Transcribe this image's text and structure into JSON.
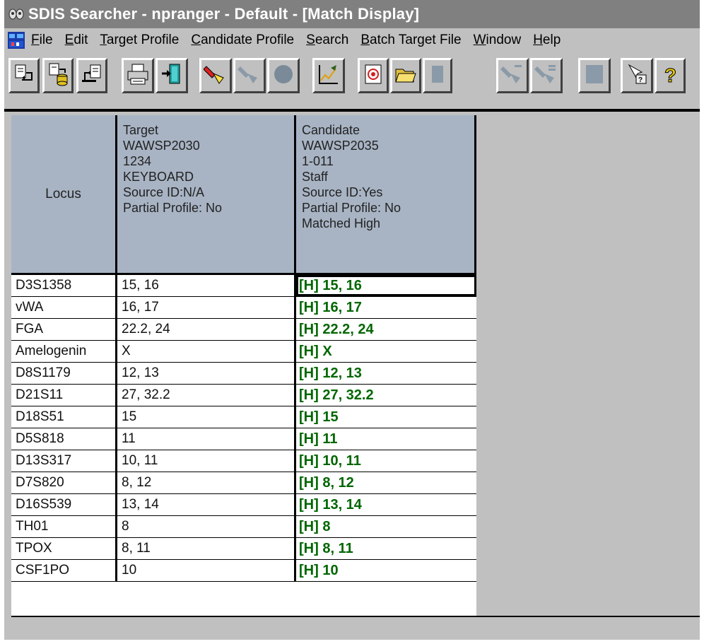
{
  "window": {
    "title": "SDIS Searcher - npranger - Default - [Match Display]"
  },
  "menu": [
    {
      "label": "File"
    },
    {
      "label": "Edit"
    },
    {
      "label": "Target Profile"
    },
    {
      "label": "Candidate Profile"
    },
    {
      "label": "Search"
    },
    {
      "label": "Batch Target File"
    },
    {
      "label": "Window"
    },
    {
      "label": "Help"
    }
  ],
  "toolbar": {
    "buttons": [
      {
        "icon": "import-target-icon"
      },
      {
        "icon": "import-database-icon"
      },
      {
        "icon": "export-icon"
      },
      {
        "icon": "printer-icon"
      },
      {
        "icon": "exit-door-icon"
      },
      {
        "icon": "flashlight-search-icon"
      },
      {
        "icon": "flashlight-disabled-icon"
      },
      {
        "icon": "circle-disabled-icon"
      },
      {
        "icon": "chart-draw-icon"
      },
      {
        "icon": "target-icon"
      },
      {
        "icon": "open-folder-icon"
      },
      {
        "icon": "blank-disabled-icon"
      },
      {
        "icon": "flashlight-batch-disabled-icon"
      },
      {
        "icon": "flashlight-batch2-disabled-icon"
      },
      {
        "icon": "page-disabled-icon"
      },
      {
        "icon": "pointer-help-icon"
      },
      {
        "icon": "question-icon"
      }
    ]
  },
  "grid": {
    "header": {
      "locus": "Locus",
      "target": [
        "Target",
        "WAWSP2030",
        "1234",
        "KEYBOARD",
        "Source ID:N/A",
        "Partial Profile: No"
      ],
      "candidate": [
        "Candidate",
        "WAWSP2035",
        "1-011",
        "Staff",
        "Source ID:Yes",
        "Partial Profile: No",
        "Matched High"
      ]
    },
    "rows": [
      {
        "locus": "D3S1358",
        "target": "15, 16",
        "candidate": "[H] 15, 16"
      },
      {
        "locus": "vWA",
        "target": "16, 17",
        "candidate": "[H] 16, 17"
      },
      {
        "locus": "FGA",
        "target": "22.2, 24",
        "candidate": "[H] 22.2, 24"
      },
      {
        "locus": "Amelogenin",
        "target": "X",
        "candidate": "[H] X"
      },
      {
        "locus": "D8S1179",
        "target": "12, 13",
        "candidate": "[H] 12, 13"
      },
      {
        "locus": "D21S11",
        "target": "27, 32.2",
        "candidate": "[H] 27, 32.2"
      },
      {
        "locus": "D18S51",
        "target": "15",
        "candidate": "[H] 15"
      },
      {
        "locus": "D5S818",
        "target": "11",
        "candidate": "[H] 11"
      },
      {
        "locus": "D13S317",
        "target": "10, 11",
        "candidate": "[H] 10, 11"
      },
      {
        "locus": "D7S820",
        "target": "8, 12",
        "candidate": "[H] 8, 12"
      },
      {
        "locus": "D16S539",
        "target": "13, 14",
        "candidate": "[H] 13, 14"
      },
      {
        "locus": "TH01",
        "target": "8",
        "candidate": "[H] 8"
      },
      {
        "locus": "TPOX",
        "target": "8, 11",
        "candidate": "[H] 8, 11"
      },
      {
        "locus": "CSF1PO",
        "target": "10",
        "candidate": "[H] 10"
      }
    ]
  },
  "colors": {
    "match_text": "#006600",
    "header_bg": "#a8b4c4",
    "chrome": "#c0c0c0",
    "titlebar": "#808080"
  }
}
